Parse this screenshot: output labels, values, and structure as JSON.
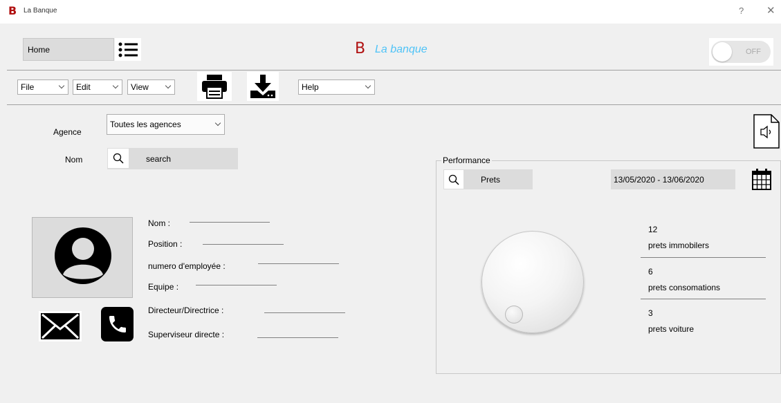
{
  "window": {
    "title": "La Banque",
    "help_glyph": "?",
    "close_glyph": "✕"
  },
  "header": {
    "nav_field": "Home",
    "brand_letter": "B",
    "brand_name": "La banque",
    "toggle_label": "OFF",
    "toggle_state": "off",
    "brand_color": "#b01010",
    "brand_name_color": "#4fc3f7"
  },
  "toolbar": {
    "menus": [
      "File",
      "Edit",
      "View"
    ],
    "help_menu": "Help",
    "icons": [
      "print-icon",
      "download-icon"
    ]
  },
  "filters": {
    "agence_label": "Agence",
    "agence_value": "Toutes les agences",
    "nom_label": "Nom",
    "search_placeholder": "search"
  },
  "employee": {
    "fields": [
      "Nom :",
      "Position :",
      "numero d'employée :",
      "Equipe :",
      "Directeur/Directrice :",
      "Superviseur directe :"
    ],
    "icons": [
      "avatar-icon",
      "mail-icon",
      "phone-icon"
    ]
  },
  "performance": {
    "title": "Performance",
    "search_value": "Prets",
    "date_range": "13/05/2020 - 13/06/2020",
    "stats": [
      {
        "count": "12",
        "label": "prets immobilers"
      },
      {
        "count": "6",
        "label": "prets consomations"
      },
      {
        "count": "3",
        "label": "prets voiture"
      }
    ]
  }
}
